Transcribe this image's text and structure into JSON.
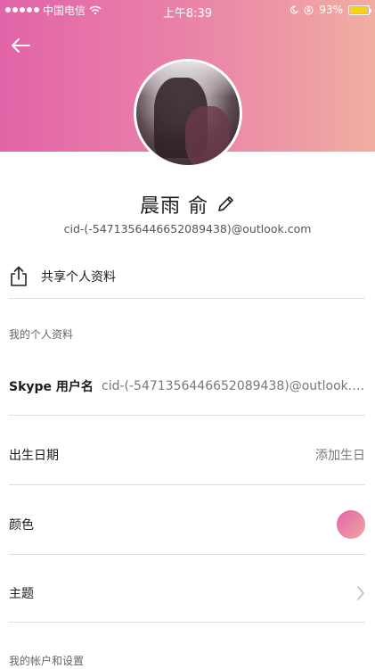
{
  "status_bar": {
    "carrier": "中国电信",
    "time": "上午8:39",
    "battery": "93%",
    "battery_level": 0.93
  },
  "profile": {
    "name": "晨雨 俞",
    "email": "cid-(-5471356446652089438)@outlook.com"
  },
  "share": {
    "label": "共享个人资料"
  },
  "sections": {
    "my_profile": "我的个人资料",
    "account": "我的帐户和设置"
  },
  "rows": {
    "skype": {
      "label": "Skype 用户名",
      "value": "cid-(-5471356446652089438)@outlook.com"
    },
    "birthday": {
      "label": "出生日期",
      "value": "添加生日"
    },
    "color": {
      "label": "颜色"
    },
    "theme": {
      "label": "主题"
    }
  },
  "colors": {
    "accent_start": "#e264a8",
    "accent_end": "#f1aea2"
  }
}
